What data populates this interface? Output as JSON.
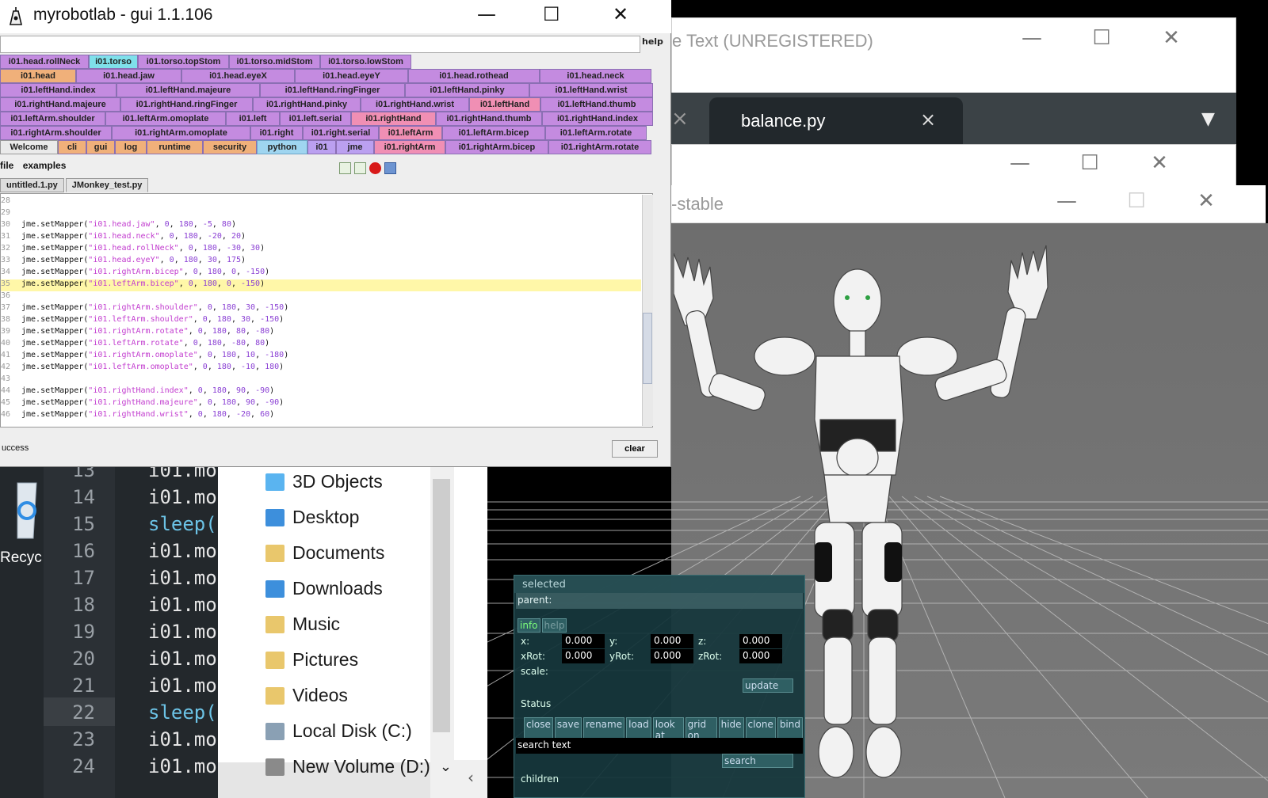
{
  "sublime": {
    "title": "e Text (UNREGISTERED)",
    "tab_label": "balance.py",
    "tab_close": "×",
    "other_tab_close": "×",
    "dropdown": "▼"
  },
  "jme": {
    "title": "-stable"
  },
  "window_controls": {
    "minimize": "—",
    "maximize": "☐",
    "close": "✕"
  },
  "selection_panel": {
    "header": "selected",
    "parent_label": "parent:",
    "info_tab": "info",
    "help_tab": "help",
    "x_label": "x:",
    "x_value": "0.000",
    "y_label": "y:",
    "y_value": "0.000",
    "z_label": "z:",
    "z_value": "0.000",
    "xrot_label": "xRot:",
    "xrot_value": "0.000",
    "yrot_label": "yRot:",
    "yrot_value": "0.000",
    "zrot_label": "zRot:",
    "zrot_value": "0.000",
    "scale_label": "scale:",
    "update_button": "update",
    "status_label": "Status",
    "buttons": [
      "close",
      "save",
      "rename",
      "load",
      "look at",
      "grid on",
      "hide",
      "clone",
      "bind"
    ],
    "search_placeholder": "search text",
    "search_button": "search",
    "children_label": "children"
  },
  "editor": {
    "line_numbers": [
      "13",
      "14",
      "15",
      "16",
      "17",
      "18",
      "19",
      "20",
      "21",
      "22",
      "23",
      "24"
    ],
    "lines": [
      "i01.mo",
      "i01.mo",
      "sleep(",
      "i01.mo",
      "i01.mo",
      "i01.mo",
      "i01.mo",
      "i01.mo",
      "i01.mo",
      "sleep(",
      "i01.mo",
      "i01.mo"
    ]
  },
  "desktop": {
    "recycle_label": "Recyc"
  },
  "explorer": {
    "items": [
      {
        "label": "3D Objects",
        "icon": "3d-objects-icon",
        "color": "#5ab4f0"
      },
      {
        "label": "Desktop",
        "icon": "desktop-icon",
        "color": "#3d8fdc"
      },
      {
        "label": "Documents",
        "icon": "documents-icon",
        "color": "#e9c76c"
      },
      {
        "label": "Downloads",
        "icon": "downloads-icon",
        "color": "#3d8fdc"
      },
      {
        "label": "Music",
        "icon": "music-icon",
        "color": "#e9c76c"
      },
      {
        "label": "Pictures",
        "icon": "pictures-icon",
        "color": "#e9c76c"
      },
      {
        "label": "Videos",
        "icon": "videos-icon",
        "color": "#e9c76c"
      },
      {
        "label": "Local Disk (C:)",
        "icon": "local-disk-icon",
        "color": "#8aa0b4"
      },
      {
        "label": "New Volume (D:)",
        "icon": "drive-icon",
        "color": "#8a8a8a"
      }
    ],
    "expand_glyph": "⌄",
    "back_glyph": "‹"
  },
  "mrl": {
    "title": "myrobotlab - gui 1.1.106",
    "help": "help",
    "tab_rows": [
      [
        [
          "i01.head.rollNeck",
          "pur",
          112
        ],
        [
          "i01.torso",
          "cyan",
          62
        ],
        [
          "i01.torso.topStom",
          "pur",
          115
        ],
        [
          "i01.torso.midStom",
          "pur",
          115
        ],
        [
          "i01.torso.lowStom",
          "pur",
          115
        ]
      ],
      [
        [
          "i01.head",
          "org",
          96
        ],
        [
          "i01.head.jaw",
          "pur",
          133
        ],
        [
          "i01.head.eyeX",
          "pur",
          143
        ],
        [
          "i01.head.eyeY",
          "pur",
          143
        ],
        [
          "i01.head.rothead",
          "pur",
          166
        ],
        [
          "i01.head.neck",
          "pur",
          141
        ]
      ],
      [
        [
          "i01.leftHand.index",
          "pur",
          147
        ],
        [
          "i01.leftHand.majeure",
          "pur",
          181
        ],
        [
          "i01.leftHand.ringFinger",
          "pur",
          183
        ],
        [
          "i01.leftHand.pinky",
          "pur",
          157
        ],
        [
          "i01.leftHand.wrist",
          "pur",
          156
        ]
      ],
      [
        [
          "i01.rightHand.majeure",
          "pur",
          152
        ],
        [
          "i01.rightHand.ringFinger",
          "pur",
          167
        ],
        [
          "i01.rightHand.pinky",
          "pur",
          136
        ],
        [
          "i01.rightHand.wrist",
          "pur",
          137
        ],
        [
          "i01.leftHand",
          "pink",
          90
        ],
        [
          "i01.leftHand.thumb",
          "pur",
          142
        ]
      ],
      [
        [
          "i01.leftArm.shoulder",
          "pur",
          133
        ],
        [
          "i01.leftArm.omoplate",
          "pur",
          152
        ],
        [
          "i01.left",
          "pur",
          68
        ],
        [
          "i01.left.serial",
          "pur",
          90
        ],
        [
          "i01.rightHand",
          "pink",
          107
        ],
        [
          "i01.rightHand.thumb",
          "pur",
          134
        ],
        [
          "i01.rightHand.index",
          "pur",
          140
        ]
      ],
      [
        [
          "i01.rightArm.shoulder",
          "pur",
          141
        ],
        [
          "i01.rightArm.omoplate",
          "pur",
          175
        ],
        [
          "i01.right",
          "pur",
          66
        ],
        [
          "i01.right.serial",
          "pur",
          96
        ],
        [
          "i01.leftArm",
          "pink",
          80
        ],
        [
          "i01.leftArm.bicep",
          "pur",
          130
        ],
        [
          "i01.leftArm.rotate",
          "pur",
          128
        ]
      ],
      [
        [
          "Welcome",
          "wh",
          73
        ],
        [
          "cli",
          "org",
          36
        ],
        [
          "gui",
          "org",
          36
        ],
        [
          "log",
          "org",
          40
        ],
        [
          "runtime",
          "org",
          71
        ],
        [
          "security",
          "org",
          68
        ],
        [
          "python",
          "sel",
          64
        ],
        [
          "i01",
          "lil",
          36
        ],
        [
          "jme",
          "lil",
          48
        ],
        [
          "i01.rightArm",
          "pink",
          90
        ],
        [
          "i01.rightArm.bicep",
          "pur",
          130
        ],
        [
          "i01.rightArm.rotate",
          "pur",
          130
        ]
      ]
    ],
    "menu_file": "file",
    "menu_examples": "examples",
    "file_tabs": [
      "untitled.1.py",
      "JMonkey_test.py"
    ],
    "code_lines": [
      {
        "n": "28",
        "t": ""
      },
      {
        "n": "29",
        "t": ""
      },
      {
        "n": "30",
        "t": "jme.setMapper(\"i01.head.jaw\", 0, 180, -5, 80)"
      },
      {
        "n": "31",
        "t": "jme.setMapper(\"i01.head.neck\", 0, 180, -20, 20)"
      },
      {
        "n": "32",
        "t": "jme.setMapper(\"i01.head.rollNeck\", 0, 180, -30, 30)"
      },
      {
        "n": "33",
        "t": "jme.setMapper(\"i01.head.eyeY\", 0, 180, 30, 175)"
      },
      {
        "n": "34",
        "t": "jme.setMapper(\"i01.rightArm.bicep\", 0, 180, 0, -150)"
      },
      {
        "n": "35",
        "t": "jme.setMapper(\"i01.leftArm.bicep\", 0, 180, 0, -150)",
        "hl": true
      },
      {
        "n": "36",
        "t": ""
      },
      {
        "n": "37",
        "t": "jme.setMapper(\"i01.rightArm.shoulder\", 0, 180, 30, -150)"
      },
      {
        "n": "38",
        "t": "jme.setMapper(\"i01.leftArm.shoulder\", 0, 180, 30, -150)"
      },
      {
        "n": "39",
        "t": "jme.setMapper(\"i01.rightArm.rotate\", 0, 180, 80, -80)"
      },
      {
        "n": "40",
        "t": "jme.setMapper(\"i01.leftArm.rotate\", 0, 180, -80, 80)"
      },
      {
        "n": "41",
        "t": "jme.setMapper(\"i01.rightArm.omoplate\", 0, 180, 10, -180)"
      },
      {
        "n": "42",
        "t": "jme.setMapper(\"i01.leftArm.omoplate\", 0, 180, -10, 180)"
      },
      {
        "n": "43",
        "t": ""
      },
      {
        "n": "44",
        "t": "jme.setMapper(\"i01.rightHand.index\", 0, 180, 90, -90)"
      },
      {
        "n": "45",
        "t": "jme.setMapper(\"i01.rightHand.majeure\", 0, 180, 90, -90)"
      },
      {
        "n": "46",
        "t": "jme.setMapper(\"i01.rightHand.wrist\", 0, 180, -20, 60)"
      }
    ],
    "status": "uccess",
    "clear": "clear"
  }
}
